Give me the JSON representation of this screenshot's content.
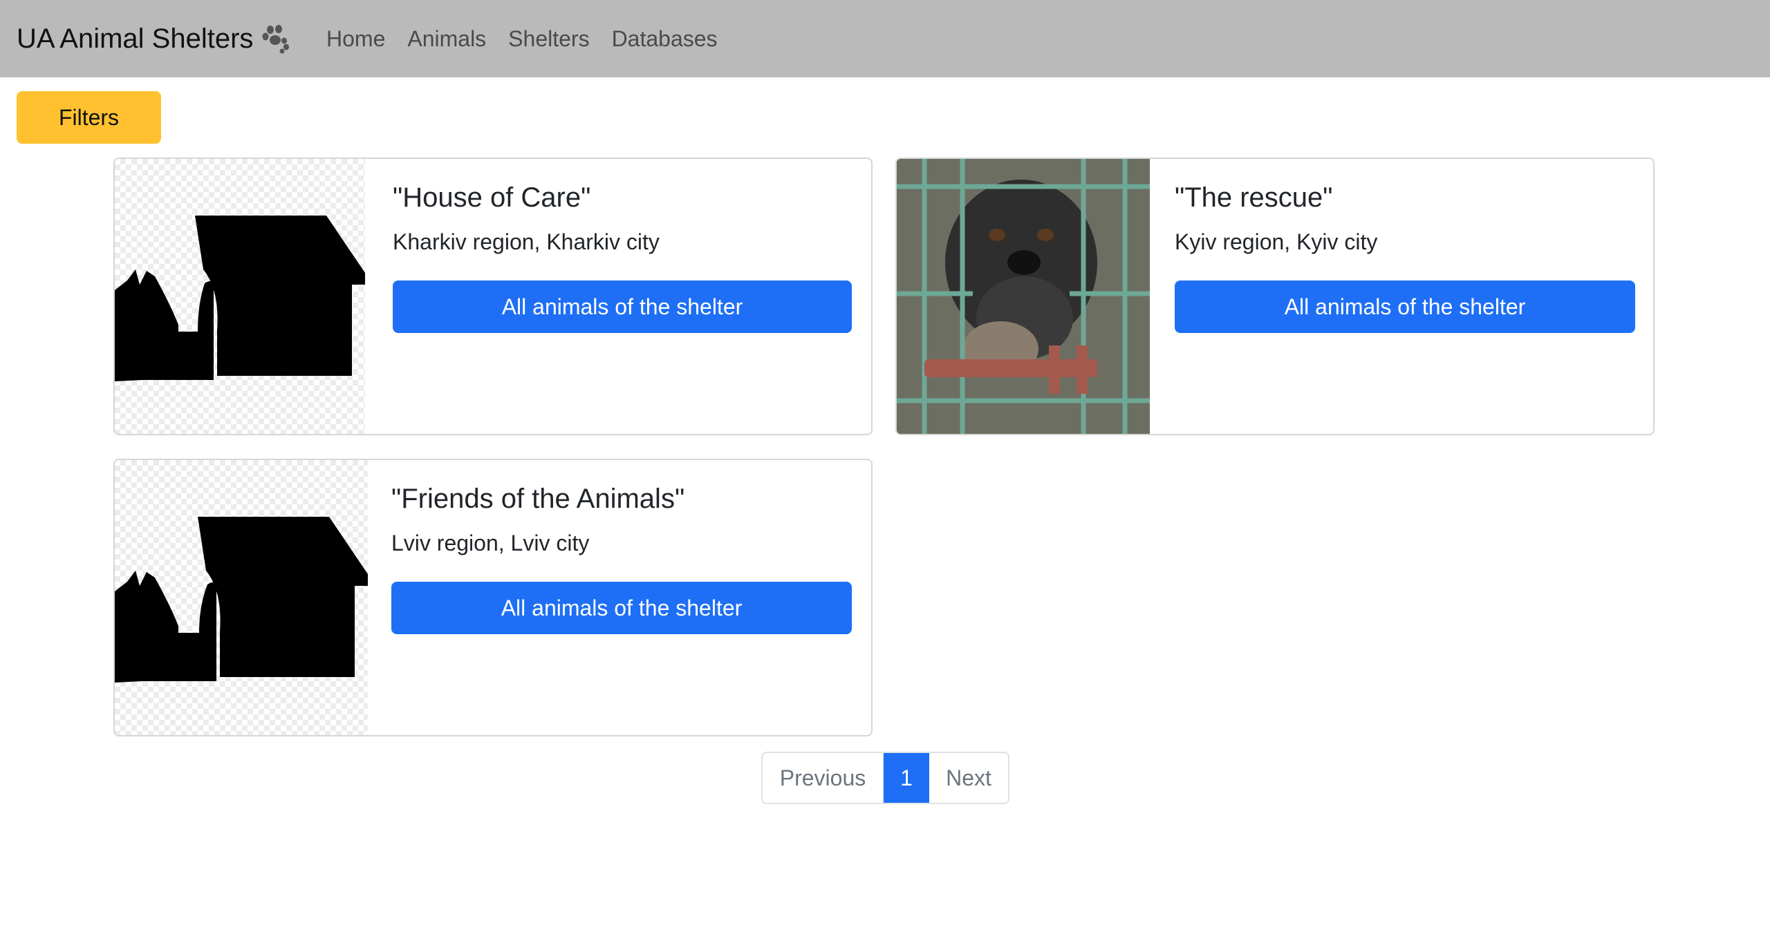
{
  "navbar": {
    "brand": "UA Animal Shelters",
    "links": [
      "Home",
      "Animals",
      "Shelters",
      "Databases"
    ]
  },
  "filters_label": "Filters",
  "shelters": [
    {
      "title": "\"House of Care\"",
      "location": "Kharkiv region, Kharkiv city",
      "button": "All animals of the shelter",
      "image": "shelter-house-icon"
    },
    {
      "title": "\"The rescue\"",
      "location": "Kyiv region, Kyiv city",
      "button": "All animals of the shelter",
      "image": "dog-photo"
    },
    {
      "title": "\"Friends of the Animals\"",
      "location": "Lviv region, Lviv city",
      "button": "All animals of the shelter",
      "image": "shelter-house-icon"
    }
  ],
  "pagination": {
    "previous": "Previous",
    "current": "1",
    "next": "Next"
  },
  "colors": {
    "navbar": "#bababa",
    "filters": "#ffc130",
    "primary": "#1e6ff5"
  }
}
